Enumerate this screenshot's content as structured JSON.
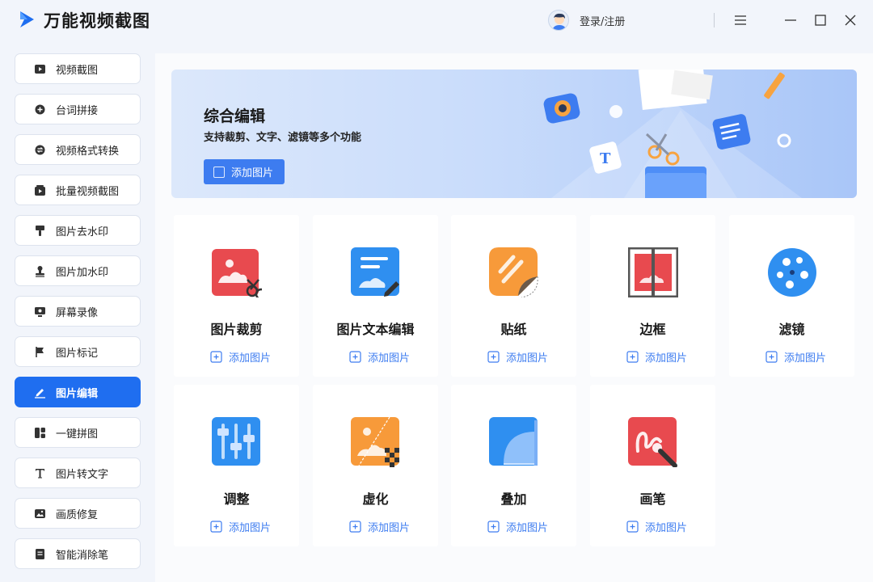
{
  "app": {
    "title": "万能视频截图",
    "login": "登录/注册"
  },
  "window_controls": {
    "menu": "menu-icon",
    "minimize": "minimize-icon",
    "maximize": "maximize-icon",
    "close": "close-icon"
  },
  "sidebar": {
    "items": [
      {
        "label": "视频截图",
        "icon": "video-screenshot-icon",
        "active": false
      },
      {
        "label": "台词拼接",
        "icon": "plus-circle-icon",
        "active": false
      },
      {
        "label": "视频格式转换",
        "icon": "convert-icon",
        "active": false
      },
      {
        "label": "批量视频截图",
        "icon": "batch-video-icon",
        "active": false
      },
      {
        "label": "图片去水印",
        "icon": "brush-icon",
        "active": false
      },
      {
        "label": "图片加水印",
        "icon": "stamp-icon",
        "active": false
      },
      {
        "label": "屏幕录像",
        "icon": "screen-record-icon",
        "active": false
      },
      {
        "label": "图片标记",
        "icon": "flag-icon",
        "active": false
      },
      {
        "label": "图片编辑",
        "icon": "edit-icon",
        "active": true
      },
      {
        "label": "一键拼图",
        "icon": "collage-icon",
        "active": false
      },
      {
        "label": "图片转文字",
        "icon": "text-icon",
        "active": false
      },
      {
        "label": "画质修复",
        "icon": "image-repair-icon",
        "active": false
      },
      {
        "label": "智能消除笔",
        "icon": "eraser-icon",
        "active": false
      }
    ]
  },
  "banner": {
    "title": "综合编辑",
    "subtitle": "支持裁剪、文字、滤镜等多个功能",
    "button": "添加图片"
  },
  "tools": [
    {
      "name": "图片裁剪",
      "add": "添加图片",
      "icon": "crop-icon",
      "color": "#e84a4f"
    },
    {
      "name": "图片文本编辑",
      "add": "添加图片",
      "icon": "text-edit-icon",
      "color": "#2f8ff0"
    },
    {
      "name": "贴纸",
      "add": "添加图片",
      "icon": "sticker-icon",
      "color": "#f79a3a"
    },
    {
      "name": "边框",
      "add": "添加图片",
      "icon": "border-icon",
      "color": "#e84a4f"
    },
    {
      "name": "滤镜",
      "add": "添加图片",
      "icon": "filter-icon",
      "color": "#2f8ff0"
    },
    {
      "name": "调整",
      "add": "添加图片",
      "icon": "adjust-icon",
      "color": "#2f8ff0"
    },
    {
      "name": "虚化",
      "add": "添加图片",
      "icon": "blur-icon",
      "color": "#f79a3a"
    },
    {
      "name": "叠加",
      "add": "添加图片",
      "icon": "overlay-icon",
      "color": "#2f8ff0"
    },
    {
      "name": "画笔",
      "add": "添加图片",
      "icon": "brush-pen-icon",
      "color": "#e84a4f"
    }
  ]
}
